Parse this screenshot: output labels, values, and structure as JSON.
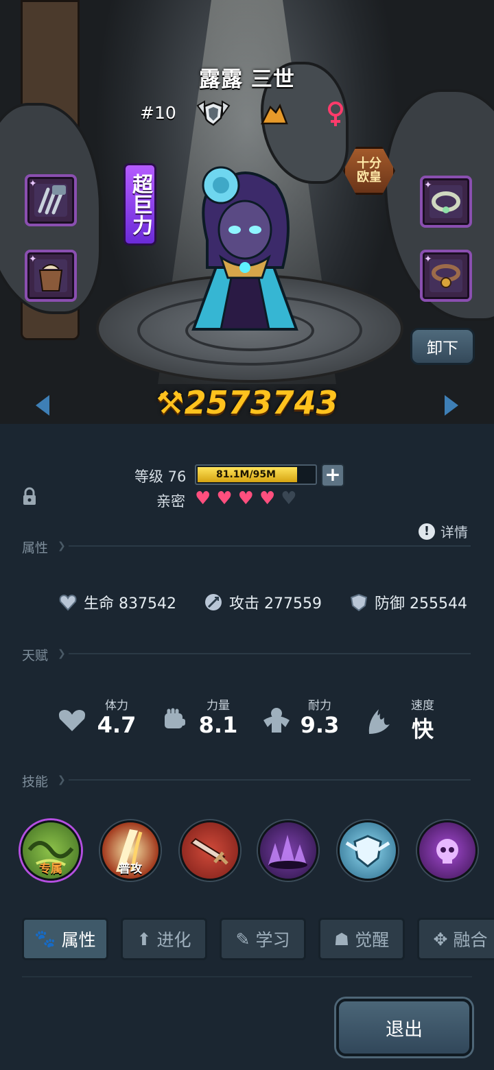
{
  "hero": {
    "name": "露露 三世",
    "rank": "#10",
    "power": "2573743",
    "trait_tag": "超巨力",
    "luck_badge_line1": "十分",
    "luck_badge_line2": "欧皇",
    "unequip_label": "卸下"
  },
  "level": {
    "label": "等级 76",
    "xp_text": "81.1M/95M",
    "xp_progress": 0.854,
    "intimacy_label": "亲密",
    "intimacy_filled": 4,
    "intimacy_total": 5
  },
  "details_label": "详情",
  "attributes": {
    "section_label": "属性",
    "hp": "生命 837542",
    "attack": "攻击 277559",
    "defense": "防御 255544"
  },
  "talents": {
    "section_label": "天赋",
    "items": [
      {
        "label": "体力",
        "value": "4.7",
        "icon": "heart-icon"
      },
      {
        "label": "力量",
        "value": "8.1",
        "icon": "fist-icon"
      },
      {
        "label": "耐力",
        "value": "9.3",
        "icon": "muscle-icon"
      },
      {
        "label": "速度",
        "value": "快",
        "icon": "wing-icon"
      }
    ]
  },
  "skills": {
    "section_label": "技能",
    "items": [
      {
        "tag": "专属",
        "icon": "nature-skill-icon"
      },
      {
        "tag": "普攻",
        "icon": "slash-skill-icon"
      },
      {
        "tag": "",
        "icon": "sword-skill-icon"
      },
      {
        "tag": "",
        "icon": "shadow-skill-icon"
      },
      {
        "tag": "",
        "icon": "shield-wing-skill-icon"
      },
      {
        "tag": "",
        "icon": "skull-skill-icon"
      }
    ]
  },
  "tabs": [
    {
      "label": "属性",
      "icon": "paw-icon",
      "active": true
    },
    {
      "label": "进化",
      "icon": "up-arrow-icon",
      "active": false
    },
    {
      "label": "学习",
      "icon": "book-icon",
      "active": false
    },
    {
      "label": "觉醒",
      "icon": "mask-icon",
      "active": false
    },
    {
      "label": "融合",
      "icon": "fusion-icon",
      "active": false
    }
  ],
  "exit_label": "退出",
  "colors": {
    "panel_bg": "#1b2631",
    "power_gold": "#ffc21e",
    "heart_pink": "#ff4f7e",
    "equip_border": "#8a4fb0"
  }
}
